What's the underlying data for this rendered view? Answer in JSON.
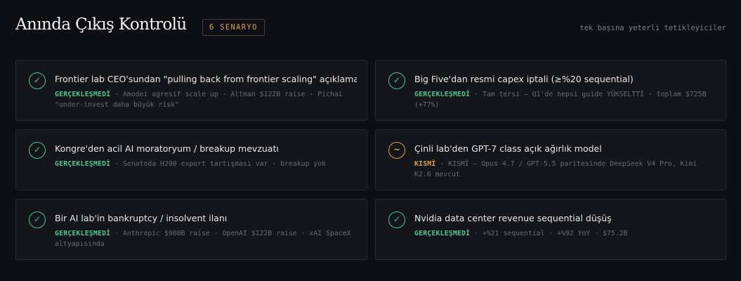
{
  "header": {
    "title": "Anında Çıkış Kontrolü",
    "badge": "6 SENARYO",
    "subtitle": "tek başına yeterli tetikleyiciler"
  },
  "colors": {
    "confirmed": "#4fc48b",
    "partial": "#d9a441",
    "accent": "#d9a441"
  },
  "scenarios": [
    {
      "icon": "check-icon",
      "title": "Frontier lab CEO'sundan \"pulling back from frontier scaling\" açıklaması",
      "status": "GERÇEKLEŞMEDİ",
      "detail": " · Amodei agresif scale up · Altman $122B raise · Pichai \"under-invest daha büyük risk\""
    },
    {
      "icon": "check-icon",
      "title": "Big Five'dan resmi capex iptali (≥%20 sequential)",
      "status": "GERÇEKLEŞMEDİ",
      "detail": " · Tam tersi — Q1'de hepsi guide YÜKSELTTİ · toplam $725B (+77%)"
    },
    {
      "icon": "check-icon",
      "title": "Kongre'den acil AI moratoryum / breakup mevzuatı",
      "status": "GERÇEKLEŞMEDİ",
      "detail": " · Senatoda H200 export tartışması var · breakup yok"
    },
    {
      "icon": "tilde-icon",
      "title": "Çinli lab'den GPT-7 class açık ağırlık model",
      "status": "KISMİ",
      "detail": " · KISMİ — Opus 4.7 / GPT-5.5 paritesinde DeepSeek V4 Pro, Kimi K2.6 mevcut"
    },
    {
      "icon": "check-icon",
      "title": "Bir AI lab'in bankruptcy / insolvent ilanı",
      "status": "GERÇEKLEŞMEDİ",
      "detail": " · Anthropic $900B raise · OpenAI $122B raise · xAI SpaceX altyapısında"
    },
    {
      "icon": "check-icon",
      "title": "Nvidia data center revenue sequential düşüş",
      "status": "GERÇEKLEŞMEDİ",
      "detail": " · +%21 sequential · +%92 YoY · $75.2B"
    }
  ],
  "icon_glyphs": {
    "check-icon": "✓",
    "tilde-icon": "~"
  }
}
